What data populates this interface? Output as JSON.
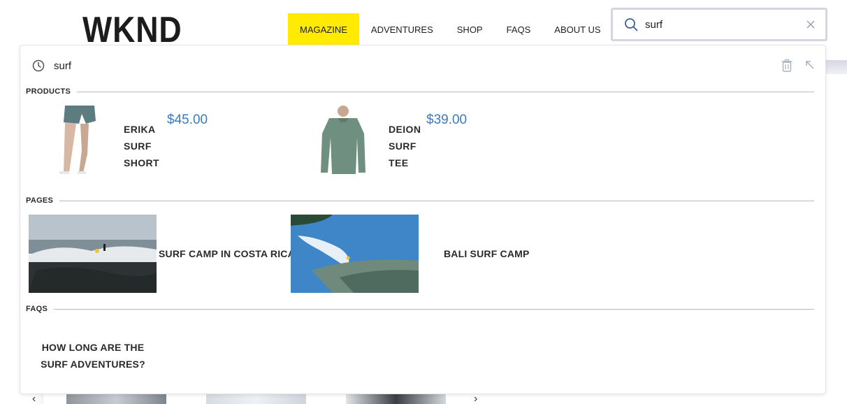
{
  "header": {
    "logo": "WKND",
    "nav": [
      "MAGAZINE",
      "ADVENTURES",
      "SHOP",
      "FAQS",
      "ABOUT US"
    ],
    "active_nav": "MAGAZINE",
    "accent_color": "#ffea00"
  },
  "search": {
    "value": "surf",
    "icon": "search-icon",
    "clear_icon": "close-icon"
  },
  "dropdown": {
    "recent_term": "surf",
    "recent_icon": "clock-icon",
    "actions": [
      "trash-icon",
      "collapse-arrow-icon"
    ],
    "sections": {
      "products": "PRODUCTS",
      "pages": "PAGES",
      "faqs": "FAQS"
    },
    "products": [
      {
        "name": "ERIKA SURF SHORT",
        "price": "$45.00"
      },
      {
        "name": "DEION SURF TEE",
        "price": "$39.00"
      }
    ],
    "pages": [
      {
        "title": "SURF CAMP IN COSTA RICA"
      },
      {
        "title": "BALI SURF CAMP"
      }
    ],
    "faqs": [
      {
        "question": "HOW LONG ARE THE SURF ADVENTURES?"
      }
    ],
    "price_color": "#3a7bbd"
  }
}
